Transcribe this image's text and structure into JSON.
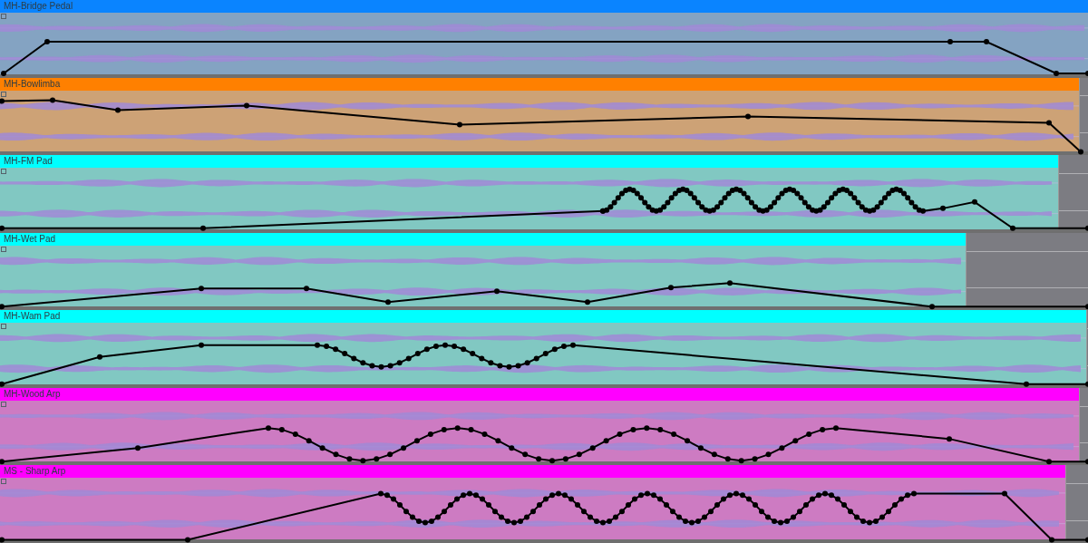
{
  "lanes": [
    {
      "name": "MH-Bridge Pedal",
      "color": "#0a84ff"
    },
    {
      "name": "MH-Bowlimba",
      "color": "#ff8000"
    },
    {
      "name": "MH-FM Pad",
      "color": "#00ffff"
    },
    {
      "name": "MH-Wet Pad",
      "color": "#00ffff"
    },
    {
      "name": "MH-Wam Pad",
      "color": "#00ffff"
    },
    {
      "name": "MH-Wood Arp",
      "color": "#ff00ff"
    },
    {
      "name": "MS - Sharp Arp",
      "color": "#ff00ff"
    }
  ]
}
